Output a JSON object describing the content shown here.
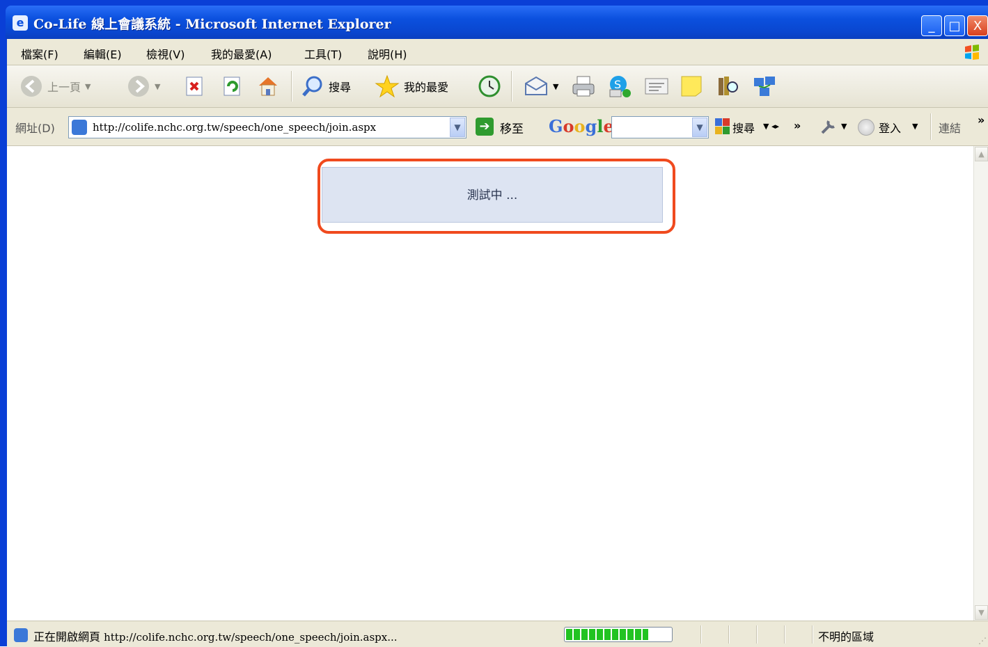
{
  "window": {
    "title": "Co-Life 線上會議系統 - Microsoft Internet Explorer",
    "controls": {
      "minimize": "_",
      "maximize": "□",
      "close": "X"
    }
  },
  "menu": [
    "檔案(F)",
    "編輯(E)",
    "檢視(V)",
    "我的最愛(A)",
    "工具(T)",
    "說明(H)"
  ],
  "toolbar": {
    "back_label": "上一頁",
    "search_label": "搜尋",
    "favorites_label": "我的最愛"
  },
  "address": {
    "label": "網址(D)",
    "url": "http://colife.nchc.org.tw/speech/one_speech/join.aspx",
    "go_label": "移至"
  },
  "google_bar": {
    "logo": "Google",
    "search_value": "",
    "search_label": "搜尋",
    "more": "»",
    "signin_label": "登入",
    "links_label": "連結",
    "links_more": "»"
  },
  "page": {
    "loading_text": "測試中 ..."
  },
  "status": {
    "text_prefix": "正在開啟網頁",
    "url": "http://colife.nchc.org.tw/speech/one_speech/join.aspx...",
    "progress": 0.95,
    "zone": "不明的區域"
  },
  "colors": {
    "titlebar": "#0b50de",
    "highlight": "#f04a1e",
    "panel": "#dde4f2",
    "progress": "#22c322"
  },
  "icons": [
    "ie-icon",
    "back-icon",
    "forward-icon",
    "stop-icon",
    "refresh-icon",
    "home-icon",
    "search-icon",
    "favorites-star-icon",
    "history-icon",
    "mail-icon",
    "print-icon",
    "skype-icon",
    "edit-icon",
    "note-icon",
    "research-icon",
    "messenger-icon",
    "windows-logo-icon",
    "google-toolbar-icon",
    "wrench-icon"
  ]
}
